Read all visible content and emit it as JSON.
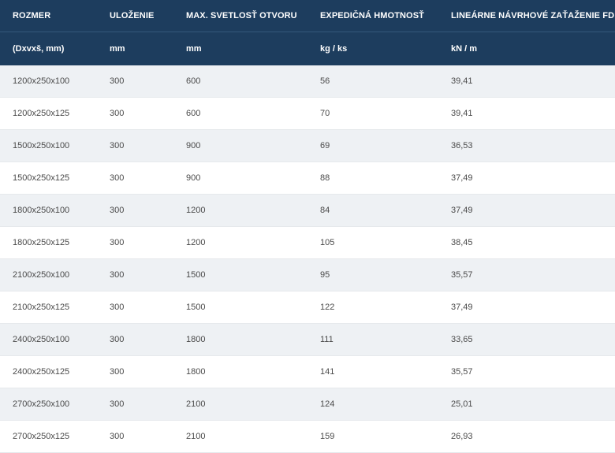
{
  "headers": [
    "ROZMER",
    "ULOŽENIE",
    "MAX. SVETLOSŤ OTVORU",
    "EXPEDIČNÁ HMOTNOSŤ",
    "LINEÁRNE NÁVRHOVÉ ZAŤAŽENIE FD"
  ],
  "units": [
    "(Dxvxš, mm)",
    "mm",
    "mm",
    "kg / ks",
    "kN / m"
  ],
  "rows": [
    [
      "1200x250x100",
      "300",
      "600",
      "56",
      "39,41"
    ],
    [
      "1200x250x125",
      "300",
      "600",
      "70",
      "39,41"
    ],
    [
      "1500x250x100",
      "300",
      "900",
      "69",
      "36,53"
    ],
    [
      "1500x250x125",
      "300",
      "900",
      "88",
      "37,49"
    ],
    [
      "1800x250x100",
      "300",
      "1200",
      "84",
      "37,49"
    ],
    [
      "1800x250x125",
      "300",
      "1200",
      "105",
      "38,45"
    ],
    [
      "2100x250x100",
      "300",
      "1500",
      "95",
      "35,57"
    ],
    [
      "2100x250x125",
      "300",
      "1500",
      "122",
      "37,49"
    ],
    [
      "2400x250x100",
      "300",
      "1800",
      "111",
      "33,65"
    ],
    [
      "2400x250x125",
      "300",
      "1800",
      "141",
      "35,57"
    ],
    [
      "2700x250x100",
      "300",
      "2100",
      "124",
      "25,01"
    ],
    [
      "2700x250x125",
      "300",
      "2100",
      "159",
      "26,93"
    ]
  ]
}
